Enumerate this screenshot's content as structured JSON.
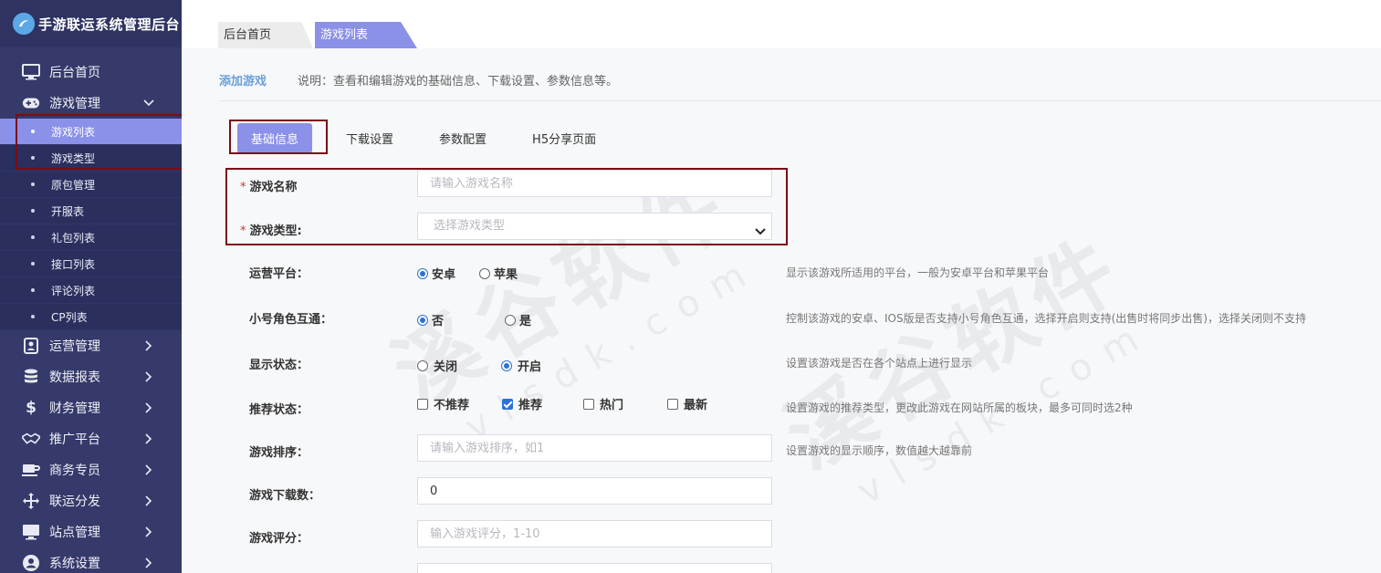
{
  "app": {
    "title": "手游联运系统管理后台"
  },
  "sidebar": {
    "items": [
      {
        "label": "后台首页",
        "icon": "monitor-icon"
      },
      {
        "label": "游戏管理",
        "icon": "gamepad-icon",
        "expanded": true,
        "children": [
          {
            "label": "游戏列表",
            "active": true
          },
          {
            "label": "游戏类型"
          },
          {
            "label": "原包管理"
          },
          {
            "label": "开服表"
          },
          {
            "label": "礼包列表"
          },
          {
            "label": "接口列表"
          },
          {
            "label": "评论列表"
          },
          {
            "label": "CP列表"
          }
        ]
      },
      {
        "label": "运营管理",
        "icon": "user-card-icon"
      },
      {
        "label": "数据报表",
        "icon": "database-icon"
      },
      {
        "label": "财务管理",
        "icon": "dollar-icon"
      },
      {
        "label": "推广平台",
        "icon": "handshake-icon"
      },
      {
        "label": "商务专员",
        "icon": "coffee-icon"
      },
      {
        "label": "联运分发",
        "icon": "move-arrows-icon"
      },
      {
        "label": "站点管理",
        "icon": "monitor-icon"
      },
      {
        "label": "系统设置",
        "icon": "user-circle-icon"
      }
    ]
  },
  "toptabs": {
    "home": "后台首页",
    "current": "游戏列表"
  },
  "page": {
    "title": "添加游戏",
    "desc": "说明：查看和编辑游戏的基础信息、下载设置、参数信息等。"
  },
  "form_tabs": [
    "基础信息",
    "下载设置",
    "参数配置",
    "H5分享页面"
  ],
  "form": {
    "req_mark": "*",
    "name": {
      "label": "游戏名称",
      "placeholder": "请输入游戏名称"
    },
    "type": {
      "label": "游戏类型:",
      "placeholder": "选择游戏类型"
    },
    "platform": {
      "label": "运营平台：",
      "options": [
        "安卓",
        "苹果"
      ],
      "selected": "安卓",
      "help": "显示该游戏所适用的平台，一般为安卓平台和苹果平台"
    },
    "role": {
      "label": "小号角色互通：",
      "options": [
        "否",
        "是"
      ],
      "selected": "否",
      "help": "控制该游戏的安卓、IOS版是否支持小号角色互通，选择开启则支持(出售时将同步出售)，选择关闭则不支持"
    },
    "status": {
      "label": "显示状态：",
      "options": [
        "关闭",
        "开启"
      ],
      "selected": "开启",
      "help": "设置该游戏是否在各个站点上进行显示"
    },
    "recommend": {
      "label": "推荐状态：",
      "options": [
        "不推荐",
        "推荐",
        "热门",
        "最新"
      ],
      "checked": [
        "推荐"
      ],
      "help": "设置游戏的推荐类型，更改此游戏在网站所属的板块，最多可同时选2种"
    },
    "sort": {
      "label": "游戏排序：",
      "placeholder": "请输入游戏排序，如1",
      "help": "设置游戏的显示顺序，数值越大越靠前"
    },
    "downloads": {
      "label": "游戏下载数：",
      "value": "0"
    },
    "score": {
      "label": "游戏评分：",
      "placeholder": "输入游戏评分，1-10"
    }
  },
  "watermark": {
    "main": "溪谷软件",
    "sub": "vlsdk.com"
  },
  "colors": {
    "sidebar": "#353a6b",
    "accent": "#8b90e8",
    "highlight": "#7a0c16",
    "link": "#6aa0d8"
  }
}
